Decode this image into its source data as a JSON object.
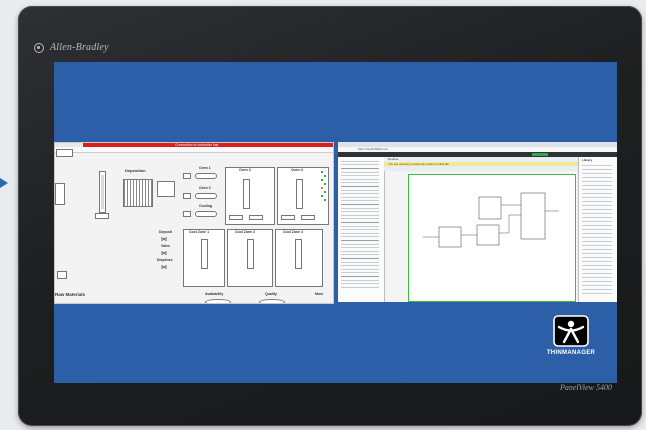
{
  "device": {
    "brand": "Allen-Bradley",
    "model": "PanelView 5400",
    "bezel_color": "#1d1f21",
    "screen_color": "#2d5fa8"
  },
  "hmi": {
    "header_warning": "Connection to controller lost",
    "deposition_title": "Deposition",
    "oven1": "Oven 1",
    "oven2": "Oven 2",
    "oven3": "Oven 3",
    "oven4": "Oven 4",
    "cooling": "Cooling",
    "deposit": "Deposit",
    "valve": "Valve",
    "dispense": "Dispense",
    "cool_zone1": "Cool Zone 1",
    "cool_zone2": "Cool Zone 2",
    "cool_zone3": "Cool Zone 3",
    "raw_materials": "Raw Materials",
    "availability": "Availability",
    "quality": "Quality",
    "more": "More"
  },
  "ide": {
    "url": "https://studio5000.com",
    "notice": "You are viewing a read-only version of this file",
    "tab": "Routine",
    "right_panel_title": "Library"
  },
  "logo": {
    "name": "THINMANAGER"
  }
}
